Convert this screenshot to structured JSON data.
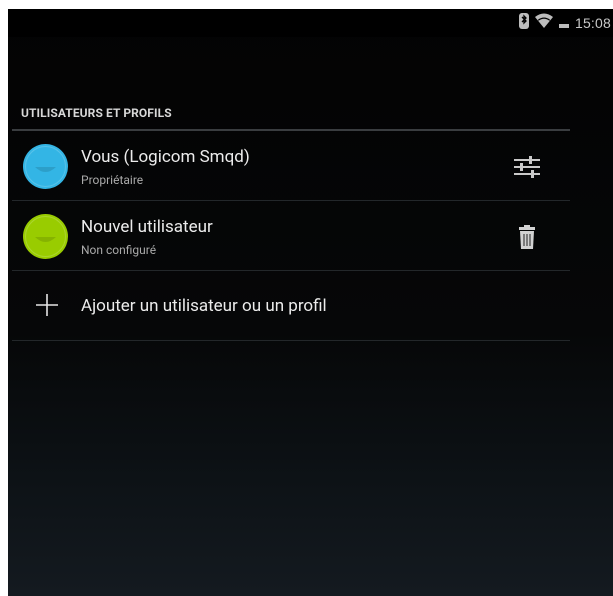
{
  "status_bar": {
    "time": "15:08",
    "icons": [
      "bluetooth-icon",
      "wifi-icon",
      "battery-icon"
    ]
  },
  "section": {
    "header": "UTILISATEURS ET PROFILS"
  },
  "users": [
    {
      "name": "Vous (Logicom Smqd)",
      "subtitle": "Propriétaire",
      "avatar_color": "#33b5e5",
      "action_icon": "settings-sliders-icon"
    },
    {
      "name": "Nouvel utilisateur",
      "subtitle": "Non configuré",
      "avatar_color": "#99cc00",
      "action_icon": "trash-icon"
    }
  ],
  "add_user": {
    "label": "Ajouter un utilisateur ou un profil",
    "icon": "plus-icon"
  },
  "colors": {
    "background": "#050607",
    "accent_blue": "#33b5e5",
    "accent_green": "#99cc00"
  }
}
